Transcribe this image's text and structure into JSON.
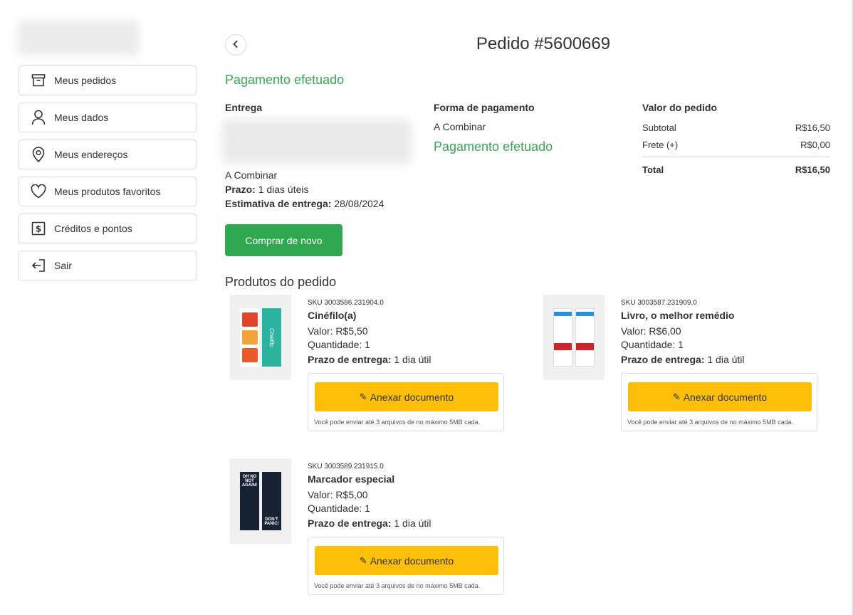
{
  "sidebar": {
    "items": [
      {
        "label": "Meus pedidos",
        "icon": "archive-box-icon"
      },
      {
        "label": "Meus dados",
        "icon": "user-icon"
      },
      {
        "label": "Meus endereços",
        "icon": "map-pin-icon"
      },
      {
        "label": "Meus produtos favoritos",
        "icon": "heart-icon"
      },
      {
        "label": "Créditos e pontos",
        "icon": "dollar-icon"
      },
      {
        "label": "Sair",
        "icon": "logout-icon"
      }
    ]
  },
  "header": {
    "title": "Pedido #5600669"
  },
  "status": "Pagamento efetuado",
  "delivery": {
    "title": "Entrega",
    "method": "A Combinar",
    "deadline_label": "Prazo:",
    "deadline_value": "1 dias úteis",
    "estimate_label": "Estimativa de entrega:",
    "estimate_value": "28/08/2024"
  },
  "payment": {
    "title": "Forma de pagamento",
    "method": "A Combinar",
    "status": "Pagamento efetuado"
  },
  "summary": {
    "title": "Valor do pedido",
    "subtotal_label": "Subtotal",
    "subtotal_value": "R$16,50",
    "shipping_label": "Frete (+)",
    "shipping_value": "R$0,00",
    "total_label": "Total",
    "total_value": "R$16,50"
  },
  "buy_again_label": "Comprar de novo",
  "products_title": "Produtos do pedido",
  "products": [
    {
      "sku": "SKU 3003586.231904.0",
      "name": "Cinéfilo(a)",
      "value": "Valor: R$5,50",
      "quantity": "Quantidade: 1",
      "delivery_label": "Prazo de entrega:",
      "delivery_value": "1 dia útil",
      "attach_label": "Anexar documento",
      "hint": "Você pode enviar até 3 arquivos de no máximo 5MB cada.",
      "thumb_text": "Cinéfilo"
    },
    {
      "sku": "SKU 3003587.231909.0",
      "name": "Livro, o melhor remédio",
      "value": "Valor: R$6,00",
      "quantity": "Quantidade: 1",
      "delivery_label": "Prazo de entrega:",
      "delivery_value": "1 dia útil",
      "attach_label": "Anexar documento",
      "hint": "Você pode enviar até 3 arquivos de no máximo 5MB cada."
    },
    {
      "sku": "SKU 3003589.231915.0",
      "name": "Marcador especial",
      "value": "Valor: R$5,00",
      "quantity": "Quantidade: 1",
      "delivery_label": "Prazo de entrega:",
      "delivery_value": "1 dia útil",
      "attach_label": "Anexar documento",
      "hint": "Você pode enviar até 3 arquivos de no máximo 5MB cada.",
      "thumb_text_top": "OH NO NOT AGAIN!",
      "thumb_text_bottom": "DON'T PANIC!"
    }
  ],
  "colors": {
    "green": "#3aa655",
    "button_green": "#2fa84f",
    "attach_yellow": "#fdbf0a"
  }
}
